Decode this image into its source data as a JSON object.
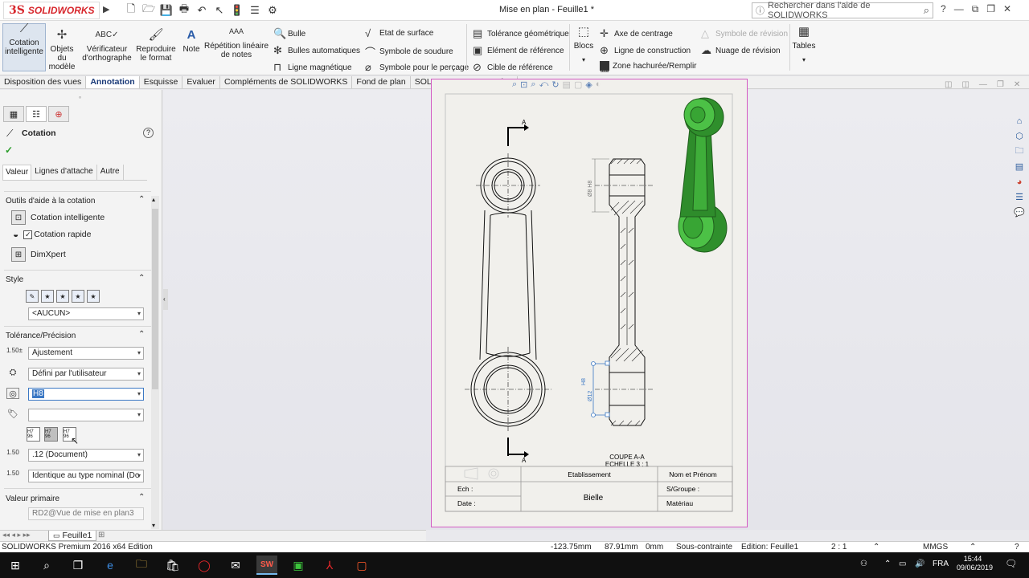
{
  "app": {
    "logo_ds": "3S",
    "logo_name": "SOLIDWORKS",
    "title": "Mise en plan - Feuille1 *",
    "search_placeholder": "Rechercher dans l'aide de SOLIDWORKS"
  },
  "ribbon": {
    "cotation_intelligente": "Cotation intelligente",
    "objets_modele": "Objets du modèle",
    "verificateur": "Vérificateur d'orthographe",
    "reproduire": "Reproduire le format",
    "note": "Note",
    "repetition": "Répétition linéaire de notes",
    "bulle": "Bulle",
    "bulles_auto": "Bulles automatiques",
    "ligne_magnetique": "Ligne magnétique",
    "etat_surface": "Etat de surface",
    "symbole_soudure": "Symbole de soudure",
    "symbole_percage": "Symbole pour le perçage",
    "tolerance_geo": "Tolérance géométrique",
    "element_ref": "Elément de référence",
    "cible_ref": "Cible de référence",
    "blocs": "Blocs",
    "axe_centrage": "Axe de centrage",
    "ligne_construction": "Ligne de construction",
    "zone_hachuree": "Zone hachurée/Remplir",
    "symbole_revision": "Symbole de révision",
    "nuage_revision": "Nuage de révision",
    "tables": "Tables"
  },
  "tabs": [
    "Disposition des vues",
    "Annotation",
    "Esquisse",
    "Evaluer",
    "Compléments de SOLIDWORKS",
    "Fond de plan",
    "SOLIDWORKS Inspection"
  ],
  "active_tab": "Annotation",
  "panel": {
    "title": "Cotation",
    "subtabs": [
      "Valeur",
      "Lignes d'attache",
      "Autre"
    ],
    "outils_title": "Outils d'aide à la cotation",
    "cotation_intelligente": "Cotation intelligente",
    "cotation_rapide": "Cotation rapide",
    "cotation_rapide_checked": true,
    "dimxpert": "DimXpert",
    "style_title": "Style",
    "style_value": "<AUCUN>",
    "tolerance_title": "Tolérance/Précision",
    "tolerance_type": "Ajustement",
    "classification": "Défini par l'utilisateur",
    "hole_fit": "H8",
    "shaft_fit": "",
    "fit_display_labels": [
      "H7 96",
      "H7 96",
      "H7 96"
    ],
    "precision_label": "1.50",
    "precision": ".12 (Document)",
    "tol_precision": "Identique au type nominal (Do",
    "valeur_primaire_title": "Valeur primaire",
    "valeur_primaire": "RD2@Vue de mise en plan3"
  },
  "sheet_tabs": [
    "Feuille1"
  ],
  "status": {
    "edition": "SOLIDWORKS Premium 2016 x64 Edition",
    "x": "-123.75mm",
    "y": "87.91mm",
    "z": "0mm",
    "state": "Sous-contrainte",
    "editing": "Edition: Feuille1",
    "scale": "2 : 1",
    "units": "MMGS"
  },
  "drawing": {
    "section_label_top": "A",
    "section_label_bottom": "A",
    "coupe_label": "COUPE A-A",
    "echelle_label": "ECHELLE 3 : 1",
    "dim_top": "Ø8 H8",
    "dim_bottom": "Ø12",
    "dim_bottom_tol": "H8",
    "etablissement": "Etablissement",
    "nom_prenom": "Nom et Prénom",
    "ech": "Ech :",
    "bielle": "Bielle",
    "sgroupe": "S/Groupe :",
    "date": "Date :",
    "materiau": "Matériau"
  },
  "taskbar": {
    "lang": "FRA",
    "time": "15:44",
    "date": "09/06/2019"
  },
  "colors": {
    "sheet_border": "#d35ac3",
    "accent": "#3b78c4",
    "part_green": "#3fae3a",
    "dim_blue": "#3b78c4"
  }
}
